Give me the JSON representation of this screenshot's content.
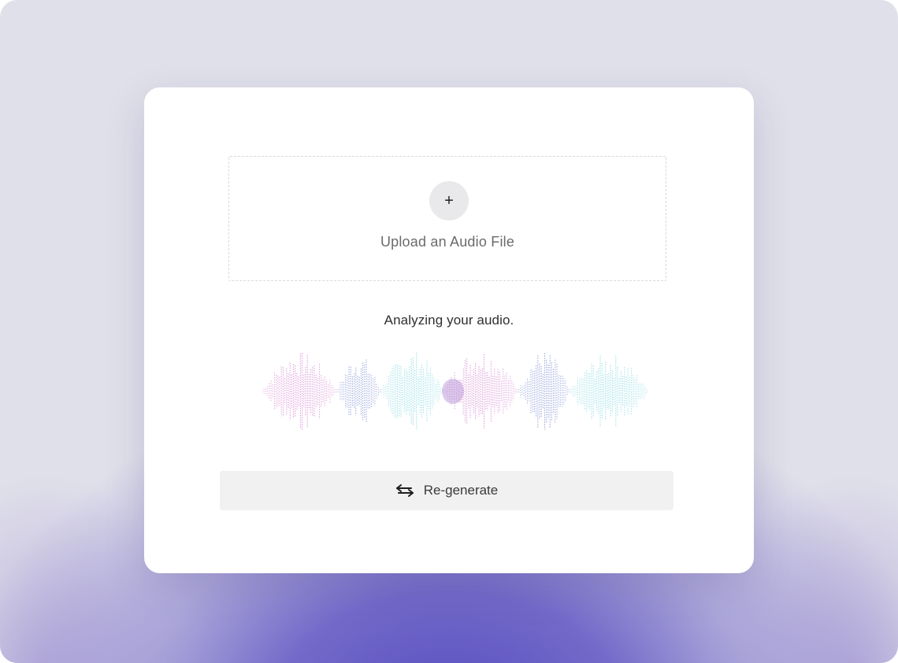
{
  "upload": {
    "plus_symbol": "+",
    "label": "Upload an Audio File"
  },
  "status": {
    "text": "Analyzing your audio."
  },
  "actions": {
    "regenerate_label": "Re-generate"
  },
  "icons": {
    "add": "plus-icon",
    "regenerate": "swap-arrows-icon"
  },
  "colors": {
    "wave_pink": "#d98fd6",
    "wave_blue": "#8f9bd8",
    "wave_cyan": "#8fdbe3",
    "wave_purple": "#9a6cc9",
    "glow": "#5b4fc0"
  }
}
